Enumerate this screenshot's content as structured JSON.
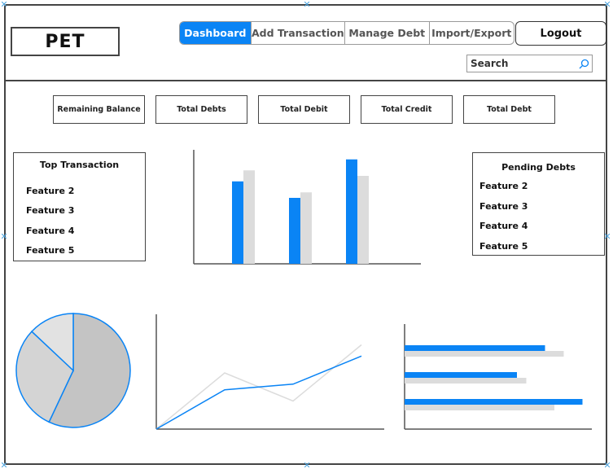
{
  "app": {
    "title": "PET"
  },
  "nav": {
    "tabs": [
      {
        "label": "Dashboard",
        "active": true
      },
      {
        "label": "Add Transaction",
        "active": false
      },
      {
        "label": "Manage Debt",
        "active": false
      },
      {
        "label": "Import/Export",
        "active": false
      }
    ],
    "logout_label": "Logout"
  },
  "search": {
    "placeholder": "Search",
    "icon": "search-icon"
  },
  "stats": [
    "Remaining Balance",
    "Total Debts",
    "Total Debit",
    "Total Credit",
    "Total Debt"
  ],
  "top_transactions": {
    "title": "Top Transaction",
    "items": [
      "Feature 2",
      "Feature 3",
      "Feature 4",
      "Feature 5"
    ]
  },
  "pending_debts": {
    "title": "Pending Debts",
    "items": [
      "Feature 2",
      "Feature 3",
      "Feature 4",
      "Feature 5"
    ]
  },
  "colors": {
    "accent": "#0a84f5",
    "gray": "#dcdcdc",
    "pie_gray": "#c4c4c4"
  },
  "chart_data": [
    {
      "type": "bar",
      "categories": [
        "",
        "",
        ""
      ],
      "series": [
        {
          "values": [
            75,
            60,
            95
          ],
          "color": "#0a84f5"
        },
        {
          "values": [
            85,
            65,
            80
          ],
          "color": "#dcdcdc"
        }
      ],
      "ylim": [
        0,
        100
      ]
    },
    {
      "type": "pie",
      "values": [
        57,
        30,
        13
      ],
      "colors": [
        "#c4c4c4",
        "#d4d4d4",
        "#e2e2e2"
      ]
    },
    {
      "type": "line",
      "x": [
        0,
        1,
        2,
        3
      ],
      "series": [
        {
          "values": [
            0,
            35,
            40,
            65
          ],
          "color": "#0a84f5"
        },
        {
          "values": [
            0,
            50,
            25,
            75
          ],
          "color": "#dcdcdc"
        }
      ],
      "ylim": [
        0,
        100
      ]
    },
    {
      "type": "bar-horizontal",
      "categories": [
        "",
        "",
        ""
      ],
      "series": [
        {
          "values": [
            75,
            60,
            95
          ],
          "color": "#0a84f5"
        },
        {
          "values": [
            85,
            65,
            80
          ],
          "color": "#dcdcdc"
        }
      ],
      "xlim": [
        0,
        100
      ]
    }
  ]
}
